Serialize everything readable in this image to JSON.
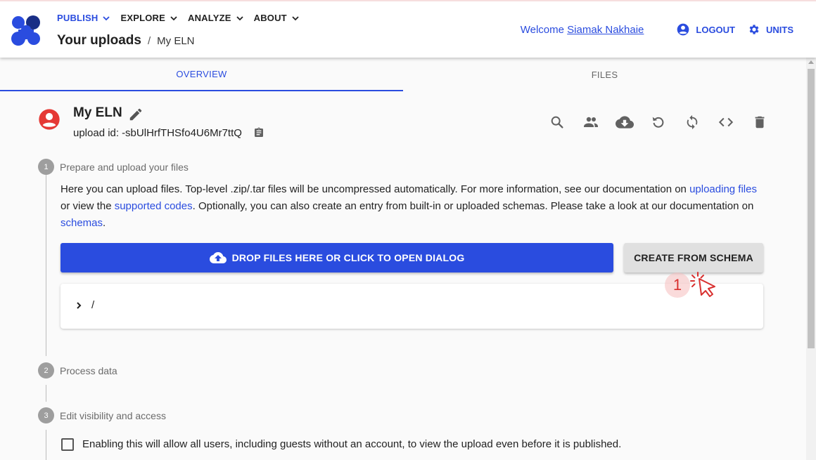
{
  "nav": {
    "items": [
      {
        "label": "PUBLISH"
      },
      {
        "label": "EXPLORE"
      },
      {
        "label": "ANALYZE"
      },
      {
        "label": "ABOUT"
      }
    ]
  },
  "breadcrumb": {
    "main": "Your uploads",
    "separator": "/",
    "sub": "My ELN"
  },
  "topright": {
    "welcome": "Welcome",
    "user": "Siamak Nakhaie",
    "logout": "LOGOUT",
    "units": "UNITS"
  },
  "tabs": [
    {
      "label": "OVERVIEW"
    },
    {
      "label": "FILES"
    }
  ],
  "upload": {
    "title": "My ELN",
    "id_label": "upload id:",
    "id_value": "-sbUlHrfTHSfo4U6Mr7ttQ"
  },
  "steps": [
    {
      "num": "1",
      "label": "Prepare and upload your files"
    },
    {
      "num": "2",
      "label": "Process data"
    },
    {
      "num": "3",
      "label": "Edit visibility and access"
    }
  ],
  "description": {
    "part1": "Here you can upload files. Top-level .zip/.tar files will be uncompressed automatically. For more information, see our documentation on ",
    "link1": "uploading files",
    "part2": " or view the ",
    "link2": "supported codes",
    "part3": ". Optionally, you can also create an entry from built-in or uploaded schemas. Please take a look at our documentation on ",
    "link3": "schemas",
    "part4": "."
  },
  "buttons": {
    "drop": "DROP FILES HERE OR CLICK TO OPEN DIALOG",
    "schema": "CREATE FROM SCHEMA"
  },
  "files": {
    "path": "/"
  },
  "marker": {
    "number": "1"
  },
  "visibility": {
    "checkbox_label": "Enabling this will allow all users, including guests without an account, to view the upload even before it is published."
  },
  "colors": {
    "primary": "#2a4cdf",
    "avatar": "#e53935",
    "marker": "#d8302f"
  }
}
